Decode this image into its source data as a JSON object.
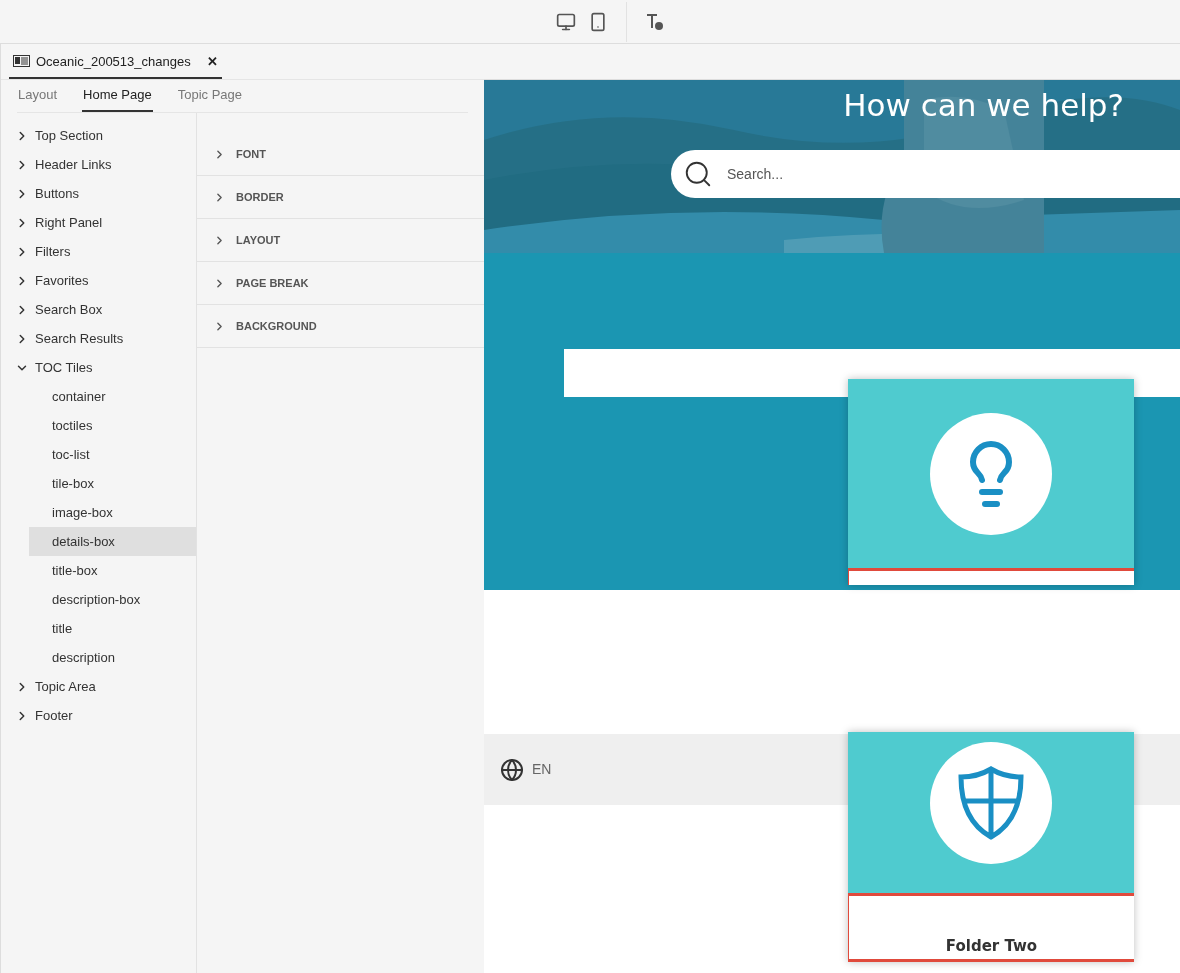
{
  "toolbar": {
    "buttons": [
      {
        "kind": "desktop",
        "selected": false
      },
      {
        "kind": "mobile",
        "selected": false
      },
      {
        "kind": "text-style",
        "selected": false
      }
    ]
  },
  "document_tab": {
    "title": "Oceanic_200513_changes",
    "close": "✕"
  },
  "tabs": [
    {
      "label": "Layout",
      "selected": false
    },
    {
      "label": "Home Page",
      "selected": true
    },
    {
      "label": "Topic Page",
      "selected": false
    }
  ],
  "tree": [
    {
      "label": "Top Section",
      "expanded": false,
      "selected": false
    },
    {
      "label": "Header Links",
      "expanded": false,
      "selected": false
    },
    {
      "label": "Buttons",
      "expanded": false,
      "selected": false
    },
    {
      "label": "Right Panel",
      "expanded": false,
      "selected": false
    },
    {
      "label": "Filters",
      "expanded": false,
      "selected": false
    },
    {
      "label": "Favorites",
      "expanded": false,
      "selected": false
    },
    {
      "label": "Search Box",
      "expanded": false,
      "selected": false
    },
    {
      "label": "Search Results",
      "expanded": false,
      "selected": false
    },
    {
      "label": "TOC Tiles",
      "expanded": true,
      "selected": false,
      "children": [
        {
          "label": "container",
          "selected": false
        },
        {
          "label": "toctiles",
          "selected": false
        },
        {
          "label": "toc-list",
          "selected": false
        },
        {
          "label": "tile-box",
          "selected": false
        },
        {
          "label": "image-box",
          "selected": false
        },
        {
          "label": "details-box",
          "selected": true
        },
        {
          "label": "title-box",
          "selected": false
        },
        {
          "label": "description-box",
          "selected": false
        },
        {
          "label": "title",
          "selected": false
        },
        {
          "label": "description",
          "selected": false
        }
      ]
    },
    {
      "label": "Topic Area",
      "expanded": false,
      "selected": false
    },
    {
      "label": "Footer",
      "expanded": false,
      "selected": false
    }
  ],
  "properties": [
    {
      "label": "FONT",
      "expanded": false
    },
    {
      "label": "BORDER",
      "expanded": false
    },
    {
      "label": "LAYOUT",
      "expanded": false
    },
    {
      "label": "PAGE BREAK",
      "expanded": false
    },
    {
      "label": "BACKGROUND",
      "expanded": false
    }
  ],
  "preview": {
    "heading": "How can we help?",
    "search": {
      "placeholder": "Search..."
    },
    "footer": {
      "language": "EN"
    },
    "tiles": [
      {
        "kind": "lightbulb"
      },
      {
        "kind": "shield",
        "title": "Folder Two"
      }
    ]
  }
}
